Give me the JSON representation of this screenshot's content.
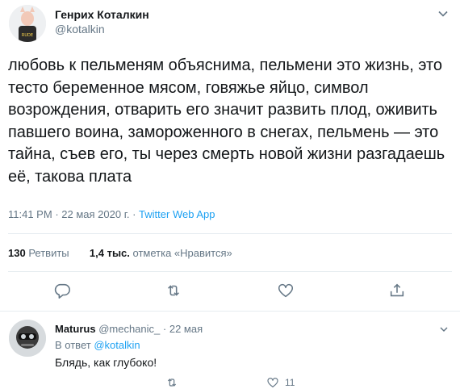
{
  "tweet": {
    "author_name": "Генрих Коталкин",
    "author_handle": "@kotalkin",
    "text": "любовь к пельменям объяснима, пельмени это жизнь, это тесто беременное мясом, говяжье яйцо, символ возрождения, отварить его значит развить плод, оживить павшего воина, замороженного в снегах, пельмень — это тайна, съев его, ты через смерть новой жизни разгадаешь её, такова плата",
    "time": "11:41 PM",
    "date": "22 мая 2020 г.",
    "source": "Twitter Web App"
  },
  "stats": {
    "retweets_count": "130",
    "retweets_label": "Ретвиты",
    "likes_count": "1,4 тыс.",
    "likes_label": "отметка «Нравится»"
  },
  "reply": {
    "author_name": "Maturus",
    "author_handle": "@mechanic_",
    "date": "22 мая",
    "reply_to_label": "В ответ",
    "reply_to_handle": "@kotalkin",
    "text": "Блядь, как глубоко!",
    "like_count": "11"
  },
  "colors": {
    "text": "#14171a",
    "secondary": "#657786",
    "link": "#1da1f2",
    "divider": "#e6ecf0"
  },
  "icons": [
    "chevron-down-icon",
    "reply-icon",
    "retweet-icon",
    "like-icon",
    "share-icon"
  ]
}
